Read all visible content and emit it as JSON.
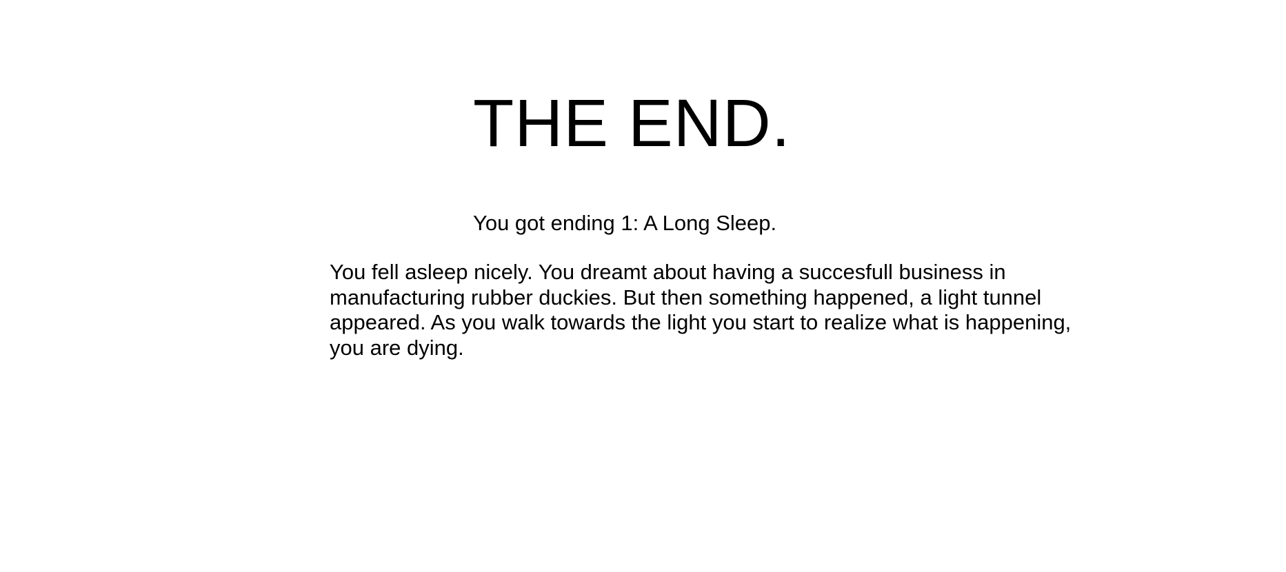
{
  "end_screen": {
    "title": "THE END.",
    "ending_text": "You got ending 1: A Long Sleep.",
    "story_text": "You fell asleep nicely. You dreamt about having a succesfull business in manufacturing rubber duckies. But then something happened, a light tunnel appeared. As you walk towards the light you start to realize what is happening, you are dying."
  }
}
